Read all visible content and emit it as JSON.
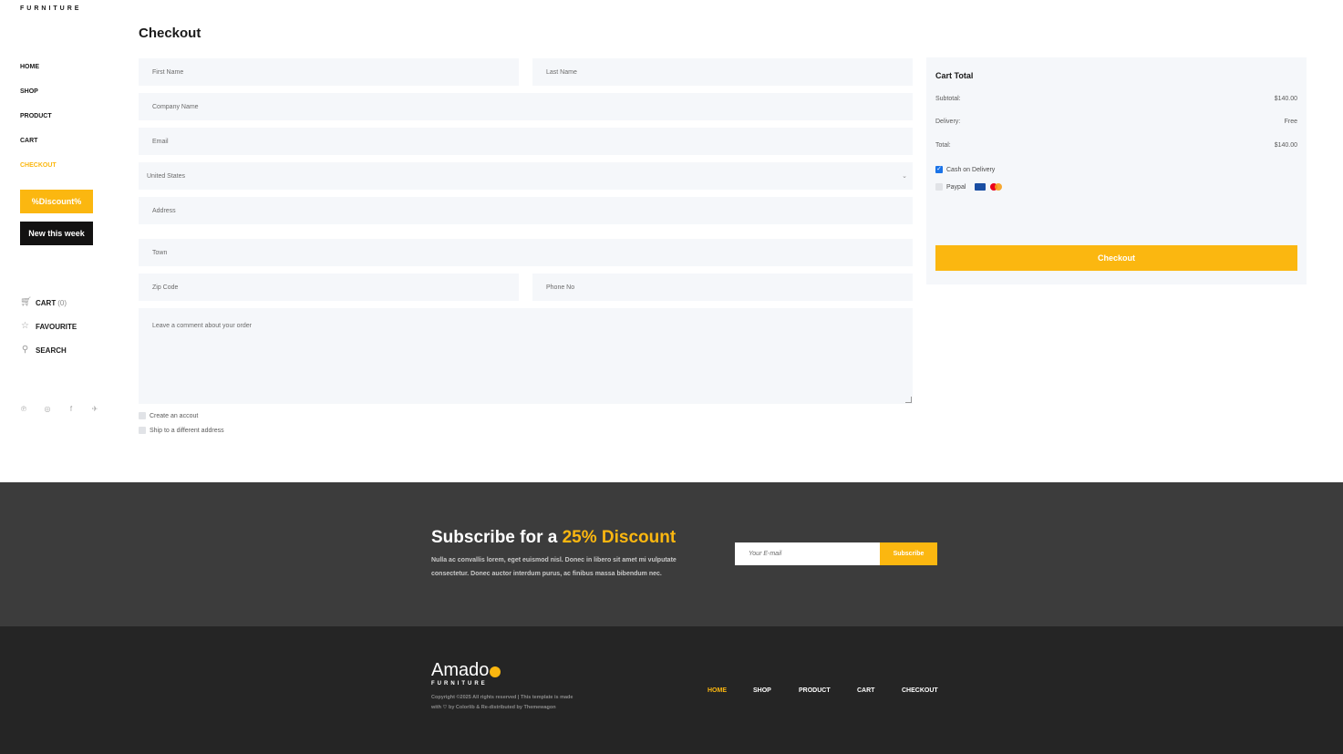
{
  "brand": {
    "top_label": "FURNITURE"
  },
  "sidebar": {
    "nav": [
      {
        "label": "HOME",
        "active": false
      },
      {
        "label": "SHOP",
        "active": false
      },
      {
        "label": "PRODUCT",
        "active": false
      },
      {
        "label": "CART",
        "active": false
      },
      {
        "label": "CHECKOUT",
        "active": true
      }
    ],
    "discount_button": "%Discount%",
    "new_button": "New this week",
    "links": {
      "cart_label": "CART",
      "cart_count": "(0)",
      "favourite_label": "FAVOURITE",
      "search_label": "SEARCH"
    },
    "socials": [
      "pinterest-icon",
      "instagram-icon",
      "facebook-icon",
      "twitter-icon"
    ]
  },
  "checkout": {
    "title": "Checkout",
    "form": {
      "first_name": "First Name",
      "last_name": "Last Name",
      "company": "Company Name",
      "email": "Email",
      "country": "United States",
      "address": "Address",
      "town": "Town",
      "zip": "Zip Code",
      "phone": "Phone No",
      "comment": "Leave a comment about your order",
      "create_account": "Create an accout",
      "ship_different": "Ship to a different address"
    }
  },
  "cart_total": {
    "title": "Cart Total",
    "rows": [
      {
        "label": "Subtotal:",
        "value": "$140.00"
      },
      {
        "label": "Delivery:",
        "value": "Free"
      },
      {
        "label": "Total:",
        "value": "$140.00"
      }
    ],
    "payments": [
      {
        "label": "Cash on Delivery",
        "checked": true
      },
      {
        "label": "Paypal",
        "checked": false
      }
    ],
    "checkout_button": "Checkout"
  },
  "newsletter": {
    "title_prefix": "Subscribe for a",
    "title_accent": "25% Discount",
    "description": "Nulla ac convallis lorem, eget euismod nisl. Donec in libero sit amet mi vulputate consectetur. Donec auctor interdum purus, ac finibus massa bibendum nec.",
    "email_placeholder": "Your E-mail",
    "subscribe_button": "Subscribe"
  },
  "footer": {
    "logo_text": "Amado",
    "logo_sub": "FURNITURE",
    "copyright_line1": "Copyright ©2025 All rights reserved | This template is made",
    "copyright_line2": "with ♡ by Colorlib & Re-distributed by Themewagon",
    "nav": [
      {
        "label": "HOME",
        "active": true
      },
      {
        "label": "SHOP",
        "active": false
      },
      {
        "label": "PRODUCT",
        "active": false
      },
      {
        "label": "CART",
        "active": false
      },
      {
        "label": "CHECKOUT",
        "active": false
      }
    ]
  },
  "colors": {
    "accent": "#fbb710",
    "dark": "#131212",
    "newsletter_bg": "#3c3c3c",
    "footer_bg": "#252525",
    "field_bg": "#f5f7fa"
  }
}
